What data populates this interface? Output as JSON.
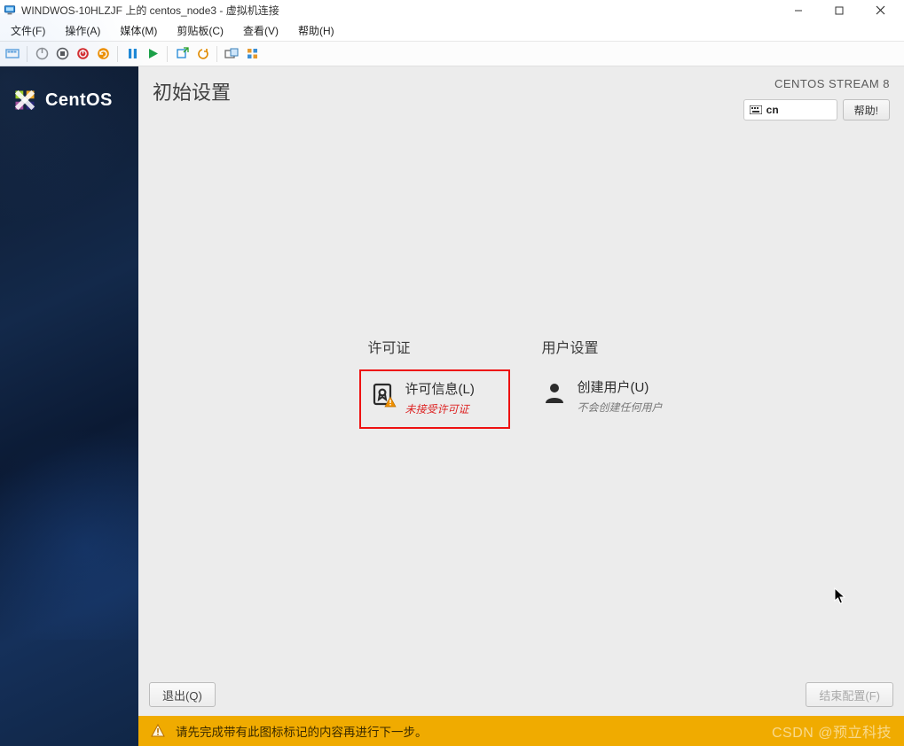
{
  "window": {
    "title": "WINDWOS-10HLZJF 上的 centos_node3 - 虚拟机连接",
    "controls": {
      "min": "—",
      "max": "□",
      "close": "×"
    }
  },
  "menu": {
    "file": "文件(F)",
    "action": "操作(A)",
    "media": "媒体(M)",
    "clipboard": "剪贴板(C)",
    "view": "查看(V)",
    "help": "帮助(H)"
  },
  "toolbar_icons": [
    "power",
    "turnoff",
    "stop",
    "shutdown",
    "reset",
    "pause",
    "play",
    "snapshot",
    "revert",
    "export",
    "capture"
  ],
  "sidebar": {
    "brand": "CentOS"
  },
  "header": {
    "title": "初始设置",
    "distro": "CENTOS STREAM 8",
    "keyboard": "cn",
    "help": "帮助!"
  },
  "sections": {
    "license": {
      "heading": "许可证",
      "card_title": "许可信息(L)",
      "card_sub": "未接受许可证"
    },
    "user": {
      "heading": "用户设置",
      "card_title": "创建用户(U)",
      "card_sub": "不会创建任何用户"
    }
  },
  "footer": {
    "quit": "退出(Q)",
    "finish": "结束配置(F)"
  },
  "warning": "请先完成带有此图标标记的内容再进行下一步。",
  "watermark": "CSDN @预立科技"
}
